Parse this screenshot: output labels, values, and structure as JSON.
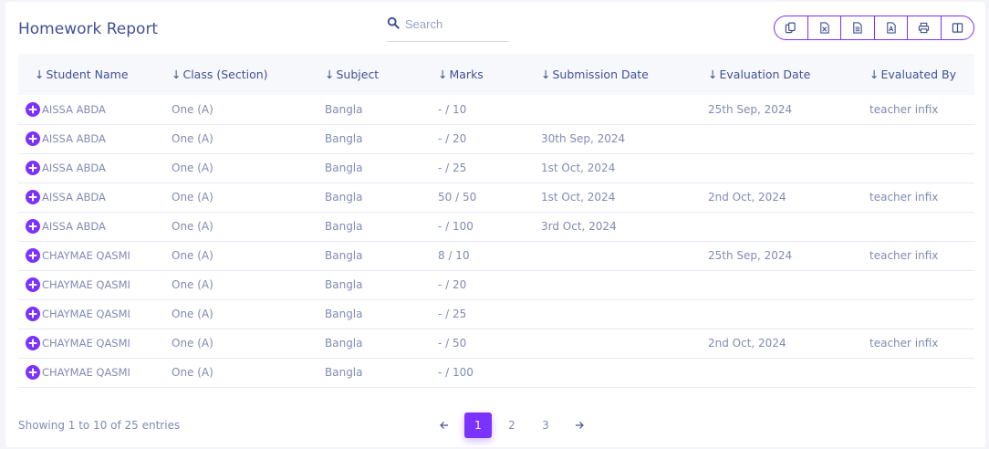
{
  "header": {
    "title": "Homework Report"
  },
  "search": {
    "placeholder": "Search",
    "value": ""
  },
  "toolbar": {
    "buttons": [
      "copy-icon",
      "excel-icon",
      "csv-icon",
      "pdf-icon",
      "print-icon",
      "columns-icon"
    ]
  },
  "table": {
    "columns": [
      "Student Name",
      "Class (Section)",
      "Subject",
      "Marks",
      "Submission Date",
      "Evaluation Date",
      "Evaluated By"
    ],
    "rows": [
      {
        "student": "AISSA ABDA",
        "class": "One (A)",
        "subject": "Bangla",
        "marks": "- / 10",
        "submission": "",
        "evaluation": "25th Sep, 2024",
        "evaluated_by": "teacher infix"
      },
      {
        "student": "AISSA ABDA",
        "class": "One (A)",
        "subject": "Bangla",
        "marks": "- / 20",
        "submission": "30th Sep, 2024",
        "evaluation": "",
        "evaluated_by": ""
      },
      {
        "student": "AISSA ABDA",
        "class": "One (A)",
        "subject": "Bangla",
        "marks": "- / 25",
        "submission": "1st Oct, 2024",
        "evaluation": "",
        "evaluated_by": ""
      },
      {
        "student": "AISSA ABDA",
        "class": "One (A)",
        "subject": "Bangla",
        "marks": "50 / 50",
        "submission": "1st Oct, 2024",
        "evaluation": "2nd Oct, 2024",
        "evaluated_by": "teacher infix"
      },
      {
        "student": "AISSA ABDA",
        "class": "One (A)",
        "subject": "Bangla",
        "marks": "- / 100",
        "submission": "3rd Oct, 2024",
        "evaluation": "",
        "evaluated_by": ""
      },
      {
        "student": "CHAYMAE QASMI",
        "class": "One (A)",
        "subject": "Bangla",
        "marks": "8 / 10",
        "submission": "",
        "evaluation": "25th Sep, 2024",
        "evaluated_by": "teacher infix"
      },
      {
        "student": "CHAYMAE QASMI",
        "class": "One (A)",
        "subject": "Bangla",
        "marks": "- / 20",
        "submission": "",
        "evaluation": "",
        "evaluated_by": ""
      },
      {
        "student": "CHAYMAE QASMI",
        "class": "One (A)",
        "subject": "Bangla",
        "marks": "- / 25",
        "submission": "",
        "evaluation": "",
        "evaluated_by": ""
      },
      {
        "student": "CHAYMAE QASMI",
        "class": "One (A)",
        "subject": "Bangla",
        "marks": "- / 50",
        "submission": "",
        "evaluation": "2nd Oct, 2024",
        "evaluated_by": "teacher infix"
      },
      {
        "student": "CHAYMAE QASMI",
        "class": "One (A)",
        "subject": "Bangla",
        "marks": "- / 100",
        "submission": "",
        "evaluation": "",
        "evaluated_by": ""
      }
    ]
  },
  "footer": {
    "info": "Showing 1 to 10 of 25 entries",
    "pages": [
      "1",
      "2",
      "3"
    ],
    "current_page": "1"
  },
  "colors": {
    "accent": "#7c32ff",
    "title": "#415094",
    "text": "#828bb2"
  }
}
